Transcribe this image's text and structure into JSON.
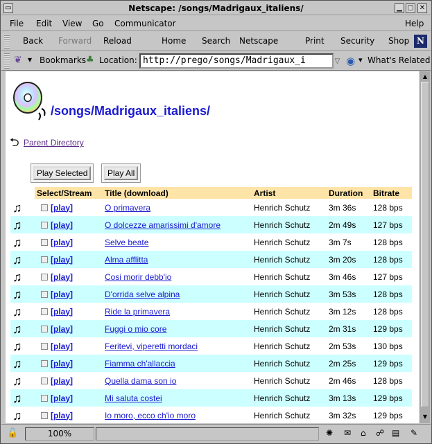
{
  "window": {
    "title": "Netscape: /songs/Madrigaux_italiens/"
  },
  "menu": [
    "File",
    "Edit",
    "View",
    "Go",
    "Communicator",
    "Help"
  ],
  "nav": {
    "back": "Back",
    "forward": "Forward",
    "reload": "Reload",
    "home": "Home",
    "search": "Search",
    "netscape": "Netscape",
    "print": "Print",
    "security": "Security",
    "shop": "Shop"
  },
  "location": {
    "bookmarks": "Bookmarks",
    "label": "Location:",
    "url": "http://prego/songs/Madrigaux_i",
    "whats_related": "What's Related"
  },
  "page": {
    "heading": "/songs/Madrigaux_italiens/",
    "parent_link": "Parent Directory",
    "play_selected": "Play Selected",
    "play_all": "Play All",
    "columns": [
      "Select/Stream",
      "Title (download)",
      "Artist",
      "Duration",
      "Bitrate"
    ],
    "play_label": "[play]",
    "songs": [
      {
        "title": "O primavera",
        "artist": "Henrich Schutz",
        "duration": "3m 36s",
        "bitrate": "128 bps"
      },
      {
        "title": "O dolcezze amarissimi d'amore",
        "artist": "Henrich Schutz",
        "duration": "2m 49s",
        "bitrate": "127 bps"
      },
      {
        "title": "Selve beate",
        "artist": "Henrich Schutz",
        "duration": "3m 7s",
        "bitrate": "128 bps"
      },
      {
        "title": "Alma afflitta",
        "artist": "Henrich Schutz",
        "duration": "3m 20s",
        "bitrate": "128 bps"
      },
      {
        "title": "Cosi morir debb'io",
        "artist": "Henrich Schutz",
        "duration": "3m 46s",
        "bitrate": "127 bps"
      },
      {
        "title": "D'orrida selve alpina",
        "artist": "Henrich Schutz",
        "duration": "3m 53s",
        "bitrate": "128 bps"
      },
      {
        "title": "Ride la primavera",
        "artist": "Henrich Schutz",
        "duration": "3m 12s",
        "bitrate": "128 bps"
      },
      {
        "title": "Fuggi o mio core",
        "artist": "Henrich Schutz",
        "duration": "2m 31s",
        "bitrate": "129 bps"
      },
      {
        "title": "Feritevi, viperetti mordaci",
        "artist": "Henrich Schutz",
        "duration": "2m 53s",
        "bitrate": "130 bps"
      },
      {
        "title": "Fiamma ch'allaccia",
        "artist": "Henrich Schutz",
        "duration": "2m 25s",
        "bitrate": "129 bps"
      },
      {
        "title": "Quella dama son io",
        "artist": "Henrich Schutz",
        "duration": "2m 46s",
        "bitrate": "128 bps"
      },
      {
        "title": "Mi saluta costei",
        "artist": "Henrich Schutz",
        "duration": "3m 13s",
        "bitrate": "129 bps"
      },
      {
        "title": "Io moro, ecco ch'io moro",
        "artist": "Henrich Schutz",
        "duration": "3m 32s",
        "bitrate": "129 bps"
      }
    ]
  },
  "status": {
    "progress": "100%"
  },
  "colors": {
    "link": "#1a1ad0",
    "visited": "#5b2a8a",
    "header_bg": "#ffe4a8",
    "alt_row_bg": "#ccffff"
  }
}
